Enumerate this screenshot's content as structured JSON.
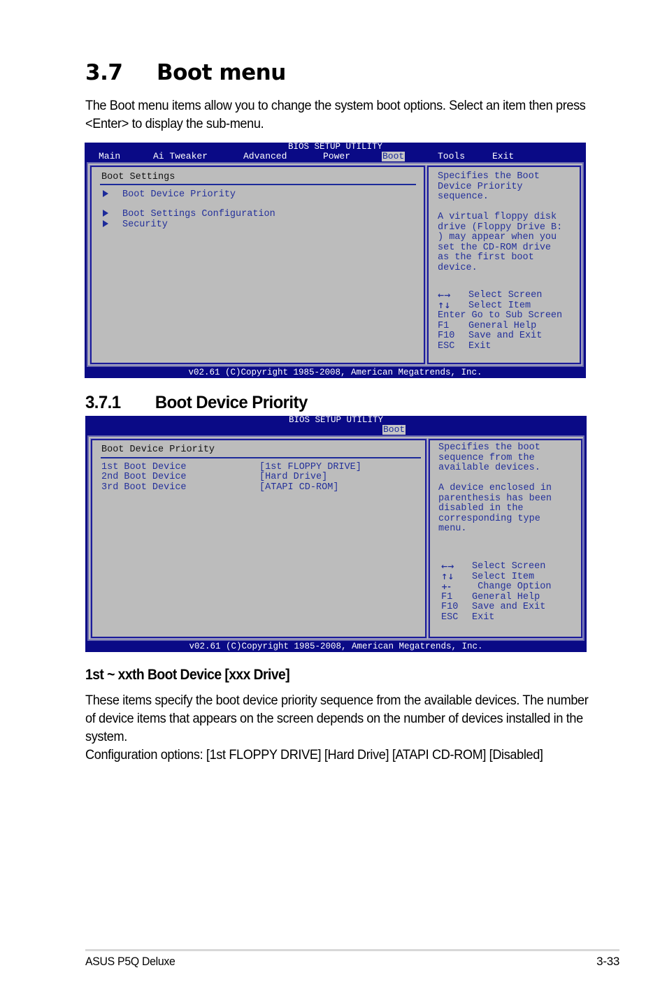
{
  "section": {
    "number": "3.7",
    "title": "Boot menu",
    "intro": "The Boot menu items allow you to change the system boot options. Select an item then press <Enter> to display the sub-menu."
  },
  "bios1": {
    "title": "BIOS SETUP UTILITY",
    "menu": [
      "Main",
      "Ai Tweaker",
      "Advanced",
      "Power",
      "Boot",
      "Tools",
      "Exit"
    ],
    "active_menu": "Boot",
    "pane_title": "Boot Settings",
    "items": [
      "Boot Device Priority",
      "Boot Settings Configuration",
      "Security"
    ],
    "help": [
      "Specifies the Boot",
      "Device Priority",
      "sequence.",
      "",
      "A virtual floppy disk",
      "drive (Floppy Drive B:",
      ") may appear when you",
      "set the CD-ROM drive",
      "as the first boot",
      "device."
    ],
    "keys": [
      {
        "key": "←→",
        "icon": "left-right-arrows-icon",
        "action": "Select Screen"
      },
      {
        "key": "↑↓",
        "icon": "up-down-arrows-icon",
        "action": "Select Item"
      },
      {
        "key": "Enter",
        "action": "Go to Sub Screen"
      },
      {
        "key": "F1",
        "action": "General Help"
      },
      {
        "key": "F10",
        "action": "Save and Exit"
      },
      {
        "key": "ESC",
        "action": "Exit"
      }
    ],
    "footer": "v02.61 (C)Copyright 1985-2008, American Megatrends, Inc."
  },
  "subsection": {
    "number": "3.7.1",
    "title": "Boot Device Priority"
  },
  "bios2": {
    "title": "BIOS SETUP UTILITY",
    "active_menu": "Boot",
    "pane_title": "Boot Device Priority",
    "devices": [
      {
        "label": "1st Boot Device",
        "value": "[1st FLOPPY DRIVE]"
      },
      {
        "label": "2nd Boot Device",
        "value": "[Hard Drive]"
      },
      {
        "label": "3rd Boot Device",
        "value": "[ATAPI CD-ROM]"
      }
    ],
    "help": [
      "Specifies the boot",
      "sequence from the",
      "available devices.",
      "",
      "A device enclosed in",
      "parenthesis has been",
      "disabled in the",
      "corresponding type",
      "menu."
    ],
    "keys": [
      {
        "key": "←→",
        "icon": "left-right-arrows-icon",
        "action": "Select Screen"
      },
      {
        "key": "↑↓",
        "icon": "up-down-arrows-icon",
        "action": "Select Item"
      },
      {
        "key": "+-",
        "icon": "plus-minus-icon",
        "action": " Change Option"
      },
      {
        "key": "F1",
        "action": "General Help"
      },
      {
        "key": "F10",
        "action": "Save and Exit"
      },
      {
        "key": "ESC",
        "action": "Exit"
      }
    ],
    "footer": "v02.61 (C)Copyright 1985-2008, American Megatrends, Inc."
  },
  "item_heading": "1st ~ xxth Boot Device [xxx Drive]",
  "item_body": [
    "These items specify the boot device priority sequence from the available devices. The number of device items that appears on the screen depends on the number of devices installed in the system.",
    "Configuration options: [1st FLOPPY DRIVE] [Hard Drive] [ATAPI CD-ROM] [Disabled]"
  ],
  "page_footer": {
    "product": "ASUS P5Q Deluxe",
    "page": "3-33"
  },
  "colors": {
    "bios_blue": "#0a0a86",
    "bios_gray": "#bcbcbc",
    "bios_text": "#23309a"
  }
}
